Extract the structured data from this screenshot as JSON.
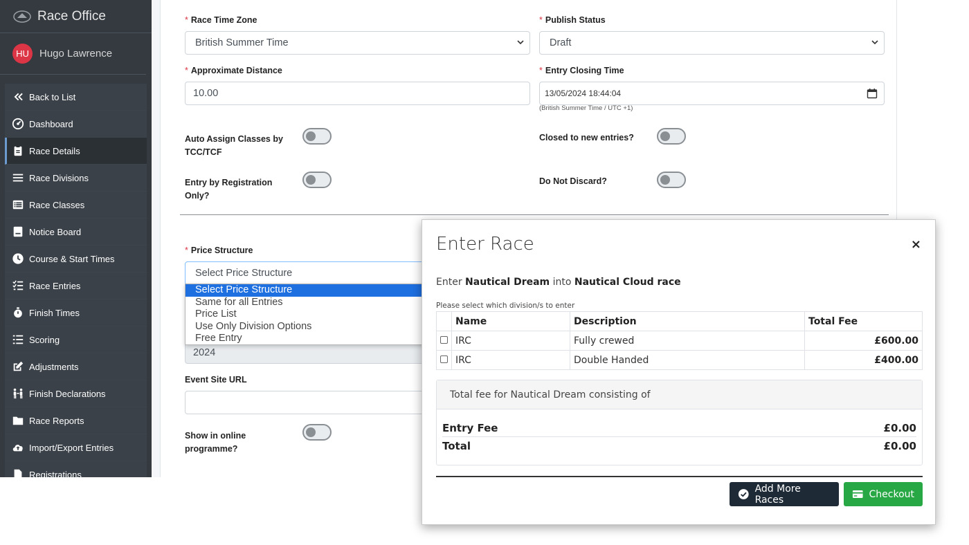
{
  "sidebar": {
    "brand": "Race Office",
    "user": {
      "initials": "HU",
      "name": "Hugo Lawrence"
    },
    "items": [
      {
        "label": "Back to List",
        "icon": "double-chevron-left-icon"
      },
      {
        "label": "Dashboard",
        "icon": "gauge-icon"
      },
      {
        "label": "Race Details",
        "icon": "clipboard-icon"
      },
      {
        "label": "Race Divisions",
        "icon": "bars-icon"
      },
      {
        "label": "Race Classes",
        "icon": "list-icon"
      },
      {
        "label": "Notice Board",
        "icon": "board-icon"
      },
      {
        "label": "Course & Start Times",
        "icon": "clock-icon"
      },
      {
        "label": "Race Entries",
        "icon": "tasks-icon"
      },
      {
        "label": "Finish Times",
        "icon": "stopwatch-icon"
      },
      {
        "label": "Scoring",
        "icon": "list-ol-icon"
      },
      {
        "label": "Adjustments",
        "icon": "edit-icon"
      },
      {
        "label": "Finish Declarations",
        "icon": "people-icon"
      },
      {
        "label": "Race Reports",
        "icon": "folder-icon"
      },
      {
        "label": "Import/Export Entries",
        "icon": "cloud-upload-icon"
      },
      {
        "label": "Registrations",
        "icon": "file-icon"
      }
    ],
    "active_index": 2
  },
  "form": {
    "required_mark": "*",
    "race_time_zone": {
      "label": "Race Time Zone",
      "value": "British Summer Time"
    },
    "publish_status": {
      "label": "Publish Status",
      "value": "Draft"
    },
    "approx_distance": {
      "label": "Approximate Distance",
      "value": "10.00"
    },
    "entry_closing_time": {
      "label": "Entry Closing Time",
      "value": "13/05/2024 18:44:04",
      "hint": "(British Summer Time / UTC +1)"
    },
    "auto_assign": {
      "label_1": "Auto Assign Classes by",
      "label_2": "TCC/TCF"
    },
    "closed_new_entries": {
      "label": "Closed to new entries?"
    },
    "entry_by_registration": {
      "label_1": "Entry by Registration",
      "label_2": "Only?"
    },
    "do_not_discard": {
      "label": "Do Not Discard?"
    },
    "price_structure": {
      "label": "Price Structure",
      "value": "Select Price Structure",
      "options": [
        "Select Price Structure",
        "Same for all Entries",
        "Price List",
        "Use Only Division Options",
        "Free Entry"
      ]
    },
    "year_value": "2024",
    "event_site_url": {
      "label": "Event Site URL",
      "value": ""
    },
    "show_online": {
      "label_1": "Show in online",
      "label_2": "programme?"
    }
  },
  "modal": {
    "title": "Enter Race",
    "close": "×",
    "enter_prefix": "Enter",
    "boat": "Nautical Dream",
    "into": "into",
    "race": "Nautical Cloud race",
    "note": "Please select which division/s to enter",
    "columns": [
      "Name",
      "Description",
      "Total Fee"
    ],
    "rows": [
      {
        "name": "IRC",
        "description": "Fully crewed",
        "fee": "£600.00"
      },
      {
        "name": "IRC",
        "description": "Double Handed",
        "fee": "£400.00"
      }
    ],
    "total_heading": "Total fee for Nautical Dream consisting of",
    "entry_fee_label": "Entry Fee",
    "entry_fee_value": "£0.00",
    "total_label": "Total",
    "total_value": "£0.00",
    "add_more_label": "Add More Races",
    "checkout_label": "Checkout"
  },
  "colors": {
    "sidebar_bg": "#343a40",
    "accent_danger": "#dc3545",
    "select_highlight": "#1e6fe0",
    "button_dark": "#1e2a36",
    "button_success": "#28a745"
  }
}
